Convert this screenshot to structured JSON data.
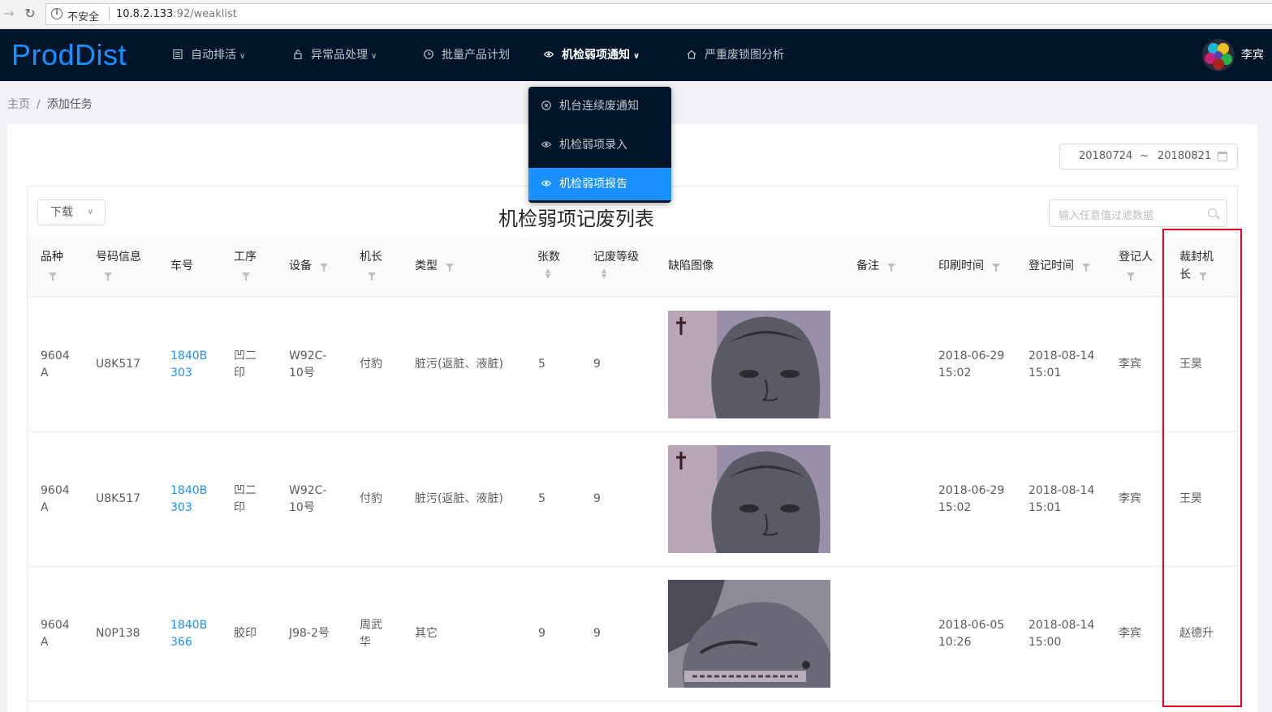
{
  "browser": {
    "insecure_label": "不安全",
    "url_host": "10.8.2.133",
    "url_path": ":92/weaklist"
  },
  "navbar": {
    "logo": "ProdDist",
    "items": [
      {
        "label": "自动排活",
        "icon": "table-icon",
        "has_caret": true
      },
      {
        "label": "异常品处理",
        "icon": "lock-icon",
        "has_caret": true
      },
      {
        "label": "批量产品计划",
        "icon": "clock-icon",
        "has_caret": false
      },
      {
        "label": "机检弱项通知",
        "icon": "eye-icon",
        "has_caret": true,
        "active": true
      },
      {
        "label": "严重废锁图分析",
        "icon": "home-icon",
        "has_caret": false
      }
    ],
    "user_name": "李宾"
  },
  "dropdown": {
    "items": [
      {
        "label": "机台连续废通知",
        "icon": "close-circle-icon"
      },
      {
        "label": "机检弱项录入",
        "icon": "eye-icon"
      },
      {
        "label": "机检弱项报告",
        "icon": "eye-icon",
        "selected": true
      }
    ]
  },
  "breadcrumb": {
    "home": "主页",
    "separator": "/",
    "current": "添加任务"
  },
  "date_range": {
    "start": "20180724",
    "separator": "~",
    "end": "20180821"
  },
  "toolbar": {
    "download_label": "下载",
    "title": "机检弱项记废列表",
    "search_placeholder": "输入任意值过滤数据"
  },
  "table": {
    "headers": {
      "variety": "品种",
      "code_info": "号码信息",
      "cart_no": "车号",
      "process": "工序",
      "device": "设备",
      "captain": "机长",
      "type": "类型",
      "sheets": "张数",
      "level": "记废等级",
      "defect_image": "缺陷图像",
      "remark": "备注",
      "print_time": "印刷时间",
      "reg_time": "登记时间",
      "registrar": "登记人",
      "cut_captain_1": "裁封机",
      "cut_captain_2": "长"
    },
    "rows": [
      {
        "variety": [
          "9604",
          "A"
        ],
        "code_info": "U8K517",
        "cart_no": [
          "1840B",
          "303"
        ],
        "process": [
          "凹二",
          "印"
        ],
        "device": [
          "W92C-",
          "10号"
        ],
        "captain": [
          "付豹"
        ],
        "type": "脏污(返脏、液脏)",
        "sheets": "5",
        "level": "9",
        "remark": "",
        "print_time": [
          "2018-06-29",
          "15:02"
        ],
        "reg_time": [
          "2018-08-14",
          "15:01"
        ],
        "registrar": "李宾",
        "cut_captain": "王昊"
      },
      {
        "variety": [
          "9604",
          "A"
        ],
        "code_info": "U8K517",
        "cart_no": [
          "1840B",
          "303"
        ],
        "process": [
          "凹二",
          "印"
        ],
        "device": [
          "W92C-",
          "10号"
        ],
        "captain": [
          "付豹"
        ],
        "type": "脏污(返脏、液脏)",
        "sheets": "5",
        "level": "9",
        "remark": "",
        "print_time": [
          "2018-06-29",
          "15:02"
        ],
        "reg_time": [
          "2018-08-14",
          "15:01"
        ],
        "registrar": "李宾",
        "cut_captain": "王昊"
      },
      {
        "variety": [
          "9604",
          "A"
        ],
        "code_info": "N0P138",
        "cart_no": [
          "1840B",
          "366"
        ],
        "process": [
          "胶印"
        ],
        "device": [
          "J98-2号"
        ],
        "captain": [
          "周武",
          "华"
        ],
        "type": "其它",
        "sheets": "9",
        "level": "9",
        "remark": "",
        "print_time": [
          "2018-06-05",
          "10:26"
        ],
        "reg_time": [
          "2018-08-14",
          "15:00"
        ],
        "registrar": "李宾",
        "cut_captain": "赵德升"
      }
    ]
  },
  "colors": {
    "navbar_bg": "#001529",
    "accent": "#1890ff",
    "highlight_border": "#e8001c"
  }
}
